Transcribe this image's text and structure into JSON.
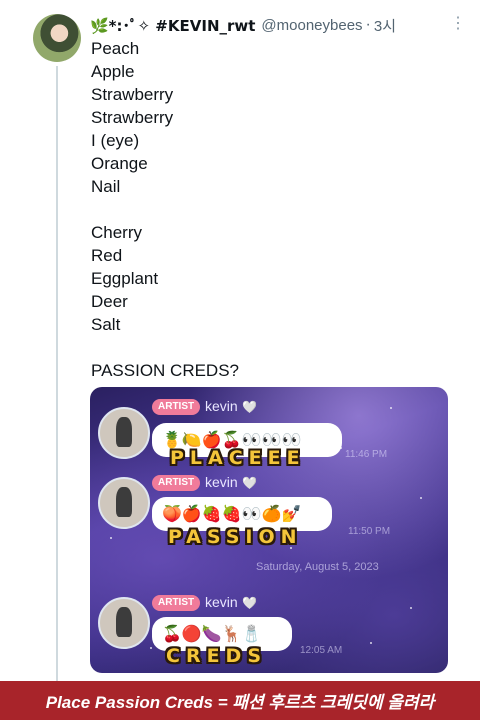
{
  "tweet": {
    "display_name": "🌿*:･ﾟ✧ #KEVIN_rwt",
    "handle": "@mooneybees",
    "dot": "·",
    "time": "3시",
    "more": "⋮",
    "lines": [
      "Peach",
      "Apple",
      "Strawberry",
      "Strawberry",
      "I (eye)",
      "Orange",
      "Nail",
      "",
      "Cherry",
      "Red",
      "Eggplant",
      "Deer",
      "Salt",
      "",
      "PASSION CREDS?"
    ]
  },
  "media": {
    "messages": [
      {
        "badge": "ARTIST",
        "name": "kevin",
        "heart": "🤍",
        "emojis": "🍍🍋🍎🍒👀👀👀",
        "overlay": "PLACEEE",
        "time": "11:46 PM"
      },
      {
        "badge": "ARTIST",
        "name": "kevin",
        "heart": "🤍",
        "emojis": "🍑🍎🍓🍓👀🍊💅",
        "overlay": "PASSION",
        "time": "11:50 PM"
      },
      {
        "badge": "ARTIST",
        "name": "kevin",
        "heart": "🤍",
        "emojis": "🍒🔴🍆🦌🧂",
        "overlay": "CREDS",
        "time": "12:05 AM"
      }
    ],
    "date_divider": "Saturday, August 5, 2023"
  },
  "caption": "Place Passion Creds = 패션 후르츠 크레딧에 올려라"
}
